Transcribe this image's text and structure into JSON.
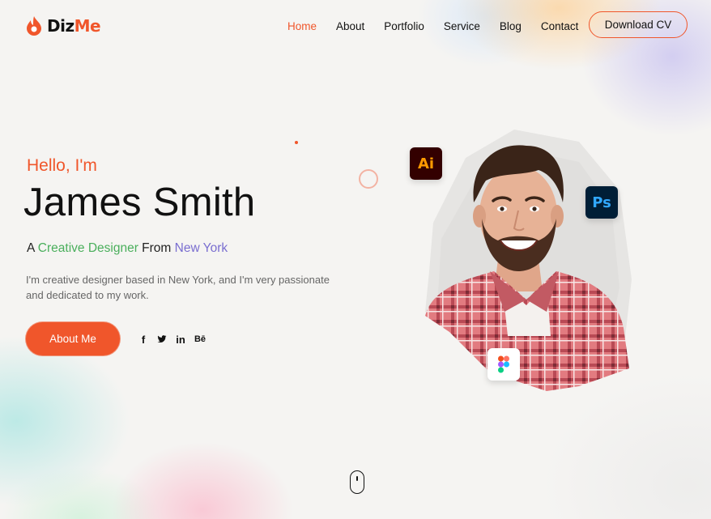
{
  "brand": {
    "part1": "Diz",
    "part2": "Me",
    "accent_color": "#f0562b"
  },
  "nav": {
    "items": [
      {
        "label": "Home",
        "active": true
      },
      {
        "label": "About"
      },
      {
        "label": "Portfolio"
      },
      {
        "label": "Service"
      },
      {
        "label": "Blog"
      },
      {
        "label": "Contact"
      }
    ],
    "cta_label": "Download CV"
  },
  "hero": {
    "greeting": "Hello, I'm",
    "name": "James Smith",
    "role_prefix": "A ",
    "role_title": "Creative Designer",
    "role_mid": " From ",
    "role_location": "New York",
    "description": "I'm creative designer based in New York, and I'm very passionate and dedicated to my work.",
    "button_label": "About Me"
  },
  "socials": [
    {
      "name": "facebook-icon",
      "glyph": "f"
    },
    {
      "name": "twitter-icon",
      "glyph": ""
    },
    {
      "name": "linkedin-icon",
      "glyph": "in"
    },
    {
      "name": "behance-icon",
      "glyph": "Bē"
    }
  ],
  "badges": {
    "illustrator": "Ai",
    "photoshop": "Ps"
  }
}
